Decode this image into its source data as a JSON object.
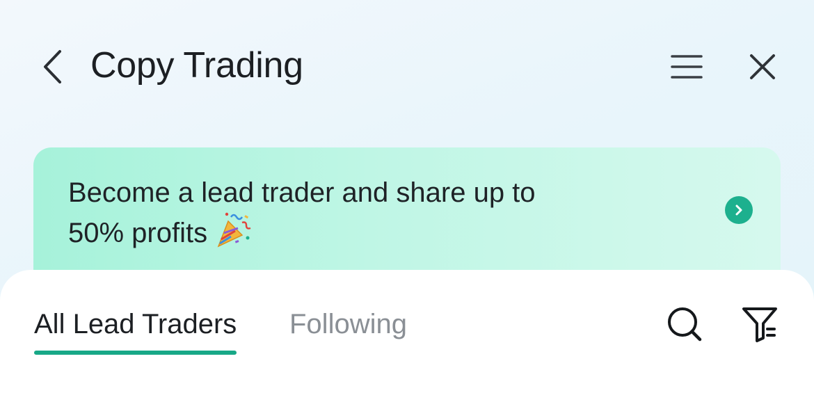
{
  "header": {
    "title": "Copy Trading",
    "icons": {
      "back": "chevron-left-icon",
      "menu": "hamburger-menu-icon",
      "close": "close-icon"
    }
  },
  "banner": {
    "line1": "Become a lead trader and share up to",
    "line2": "50% profits",
    "emoji": "party-popper-icon",
    "arrow_icon": "chevron-right-circle-icon"
  },
  "tabs": [
    {
      "label": "All Lead Traders",
      "active": true
    },
    {
      "label": "Following",
      "active": false
    }
  ],
  "toolbar": {
    "search_icon": "search-icon",
    "filter_icon": "filter-icon"
  },
  "colors": {
    "accent": "#18a887",
    "banner_start": "#a6f2da",
    "banner_end": "#d6f9ee",
    "inactive_tab": "#8a8f95",
    "text_primary": "#1c1f23"
  }
}
